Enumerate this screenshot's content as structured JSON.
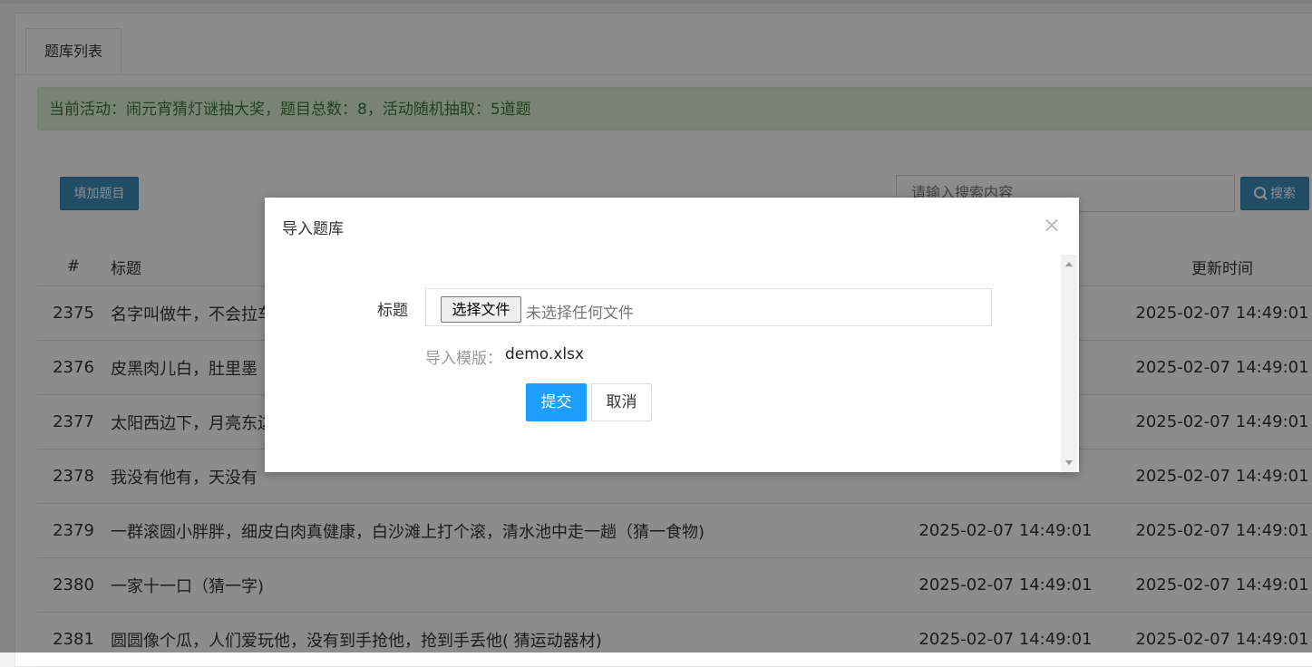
{
  "tabs": {
    "active": "题库列表"
  },
  "notice": "当前活动：闹元宵猜灯谜抽大奖，题目总数：8，活动随机抽取：5道题",
  "toolbar": {
    "add_label": "填加题目",
    "search_placeholder": "请输入搜索内容",
    "search_label": "搜索",
    "search_icon": "search-icon"
  },
  "table": {
    "headers": [
      "#",
      "标题",
      "",
      "更新时间"
    ],
    "rows": [
      {
        "id": "2375",
        "title": "名字叫做牛，不会拉车",
        "created": "",
        "updated": "2025-02-07 14:49:01"
      },
      {
        "id": "2376",
        "title": "皮黑肉儿白，肚里墨",
        "created": "",
        "updated": "2025-02-07 14:49:01"
      },
      {
        "id": "2377",
        "title": "太阳西边下，月亮东边",
        "created": "",
        "updated": "2025-02-07 14:49:01"
      },
      {
        "id": "2378",
        "title": "我没有他有，天没有",
        "created": "",
        "updated": "2025-02-07 14:49:01"
      },
      {
        "id": "2379",
        "title": "一群滚圆小胖胖，细皮白肉真健康，白沙滩上打个滚，清水池中走一趟（猜一食物)",
        "created": "2025-02-07 14:49:01",
        "updated": "2025-02-07 14:49:01"
      },
      {
        "id": "2380",
        "title": "一家十一口（猜一字)",
        "created": "2025-02-07 14:49:01",
        "updated": "2025-02-07 14:49:01"
      },
      {
        "id": "2381",
        "title": "圆圆像个瓜，人们爱玩他，没有到手抢他，抢到手丢他( 猜运动器材)",
        "created": "2025-02-07 14:49:01",
        "updated": "2025-02-07 14:49:01"
      }
    ]
  },
  "modal": {
    "title": "导入题库",
    "close": "×",
    "field_label": "标题",
    "file_button": "选择文件",
    "file_status": "未选择任何文件",
    "template_label": "导入模版：",
    "template_link": "demo.xlsx",
    "submit": "提交",
    "cancel": "取消"
  }
}
